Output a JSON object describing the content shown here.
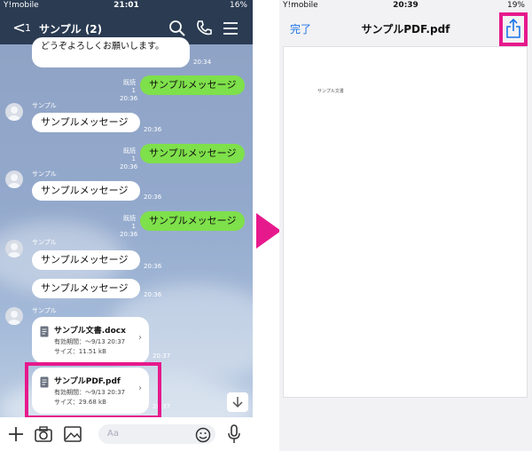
{
  "left": {
    "status": {
      "carrier": "Y!mobile",
      "time": "21:01",
      "battery": "16%"
    },
    "nav": {
      "back_glyph": "<",
      "unread": "1",
      "title": "サンプル (2)"
    },
    "top_partial": {
      "text": "どうぞよろしくお願いします。",
      "time": "20:34"
    },
    "messages": [
      {
        "dir": "out",
        "text": "サンプルメッセージ",
        "read": "既読 1",
        "time": "20:36"
      },
      {
        "dir": "in",
        "sender": "サンプル",
        "text": "サンプルメッセージ",
        "time": "20:36"
      },
      {
        "dir": "out",
        "text": "サンプルメッセージ",
        "read": "既読 1",
        "time": "20:36"
      },
      {
        "dir": "in",
        "sender": "サンプル",
        "text": "サンプルメッセージ",
        "time": "20:36"
      },
      {
        "dir": "out",
        "text": "サンプルメッセージ",
        "read": "既読 1",
        "time": "20:36"
      },
      {
        "dir": "in",
        "sender": "サンプル",
        "text": "サンプルメッセージ",
        "time": "20:36"
      },
      {
        "dir": "in",
        "text": "サンプルメッセージ",
        "time": "20:36"
      }
    ],
    "files": [
      {
        "sender": "サンプル",
        "name": "サンプル文書.docx",
        "expiry": "有効期間：～9/13 20:37",
        "size": "サイズ：11.51 kB",
        "time": "20:37"
      },
      {
        "name": "サンプルPDF.pdf",
        "expiry": "有効期間：～9/13 20:37",
        "size": "サイズ：29.68 kB",
        "time": "20:37"
      }
    ],
    "input": {
      "placeholder": "Aa"
    }
  },
  "right": {
    "status": {
      "carrier": "Y!mobile",
      "time": "20:39",
      "battery": "19%"
    },
    "nav": {
      "done_label": "完了",
      "title": "サンプルPDF.pdf"
    },
    "pdf": {
      "text": "サンプル文書"
    }
  },
  "colors": {
    "line_nav": "#2a3b52",
    "bubble_out": "#7ee04a",
    "highlight": "#e6198c",
    "ios_blue": "#1a73e8"
  },
  "icons": [
    "search-icon",
    "phone-icon",
    "menu-icon",
    "plus-icon",
    "camera-icon",
    "image-icon",
    "emoji-icon",
    "mic-icon",
    "share-icon",
    "document-icon",
    "chevron-right-icon",
    "chevron-down-icon",
    "arrow-right-icon"
  ]
}
